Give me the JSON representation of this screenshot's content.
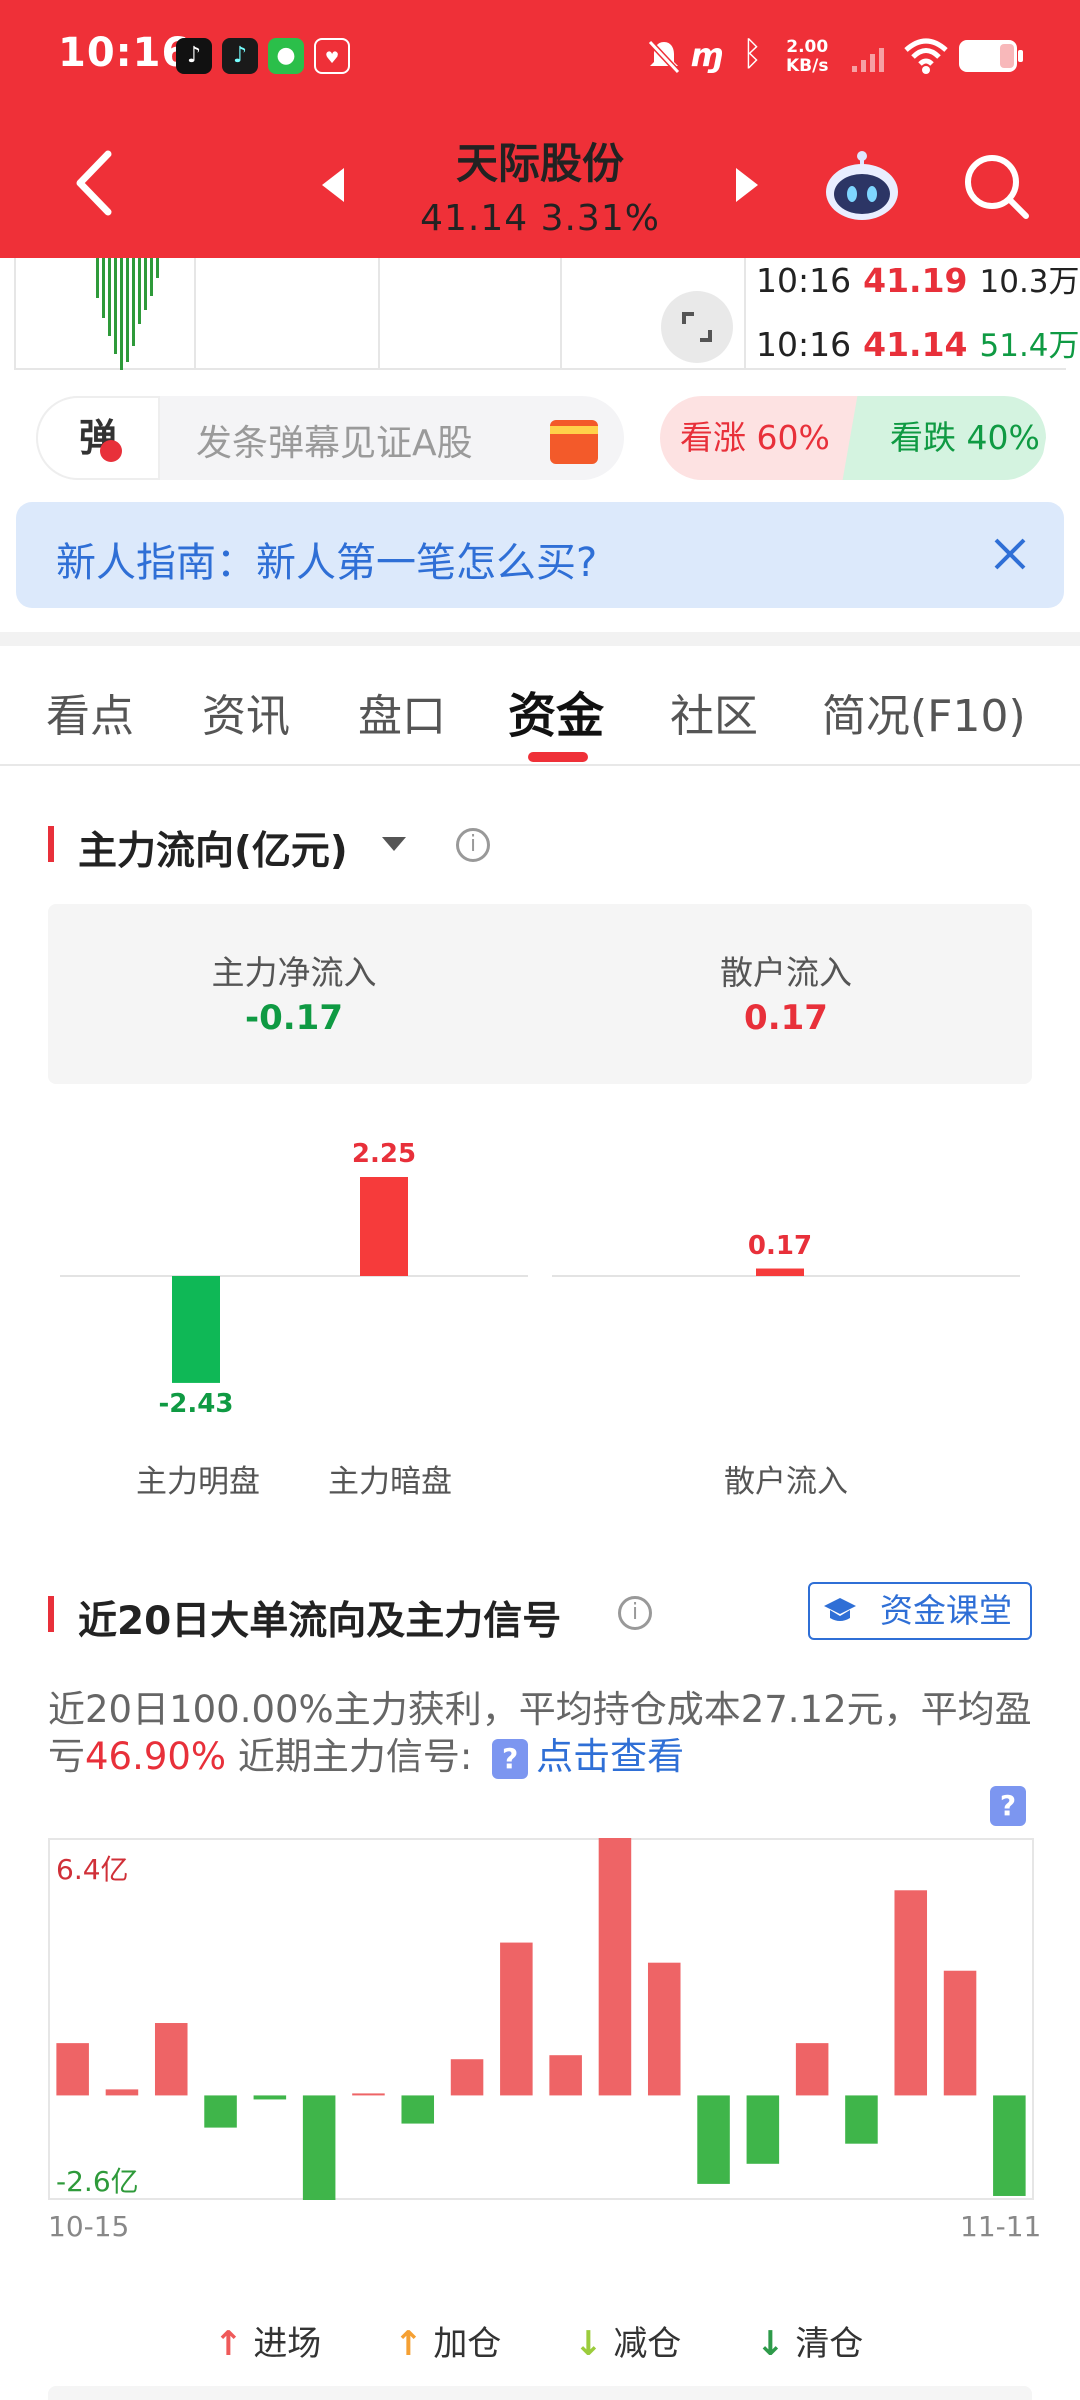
{
  "status_bar": {
    "time": "10:16",
    "net_speed_value": "2.00",
    "net_speed_unit": "KB/s",
    "app_icons": [
      "tiktok-icon",
      "tiktok-lite-icon",
      "wechat-icon",
      "taobao-1111-icon"
    ],
    "status_icons": [
      "mute-icon",
      "nfc-icon",
      "bluetooth-icon",
      "signal-icon",
      "wifi-icon",
      "battery-icon"
    ]
  },
  "header": {
    "stock_name": "天际股份",
    "price_line": "41.14 3.31%"
  },
  "ticks": [
    {
      "time": "10:16",
      "price": "41.19",
      "volume": "10.3万",
      "volume_color": "#222222"
    },
    {
      "time": "10:16",
      "price": "41.14",
      "volume": "51.4万",
      "volume_color": "#0f9a43"
    }
  ],
  "danmu": {
    "icon_label": "弹",
    "placeholder": "发条弹幕见证A股"
  },
  "sentiment": {
    "bull": "看涨 60%",
    "bear": "看跌 40%",
    "bull_pct": 60,
    "bear_pct": 40
  },
  "guide": {
    "text": "新人指南：新人第一笔怎么买?"
  },
  "tabs": [
    "看点",
    "资讯",
    "盘口",
    "资金",
    "社区",
    "简况(F10)"
  ],
  "active_tab": "资金",
  "main_flow": {
    "title": "主力流向(亿元)",
    "net_inflow_label": "主力净流入",
    "net_inflow_value": "-0.17",
    "retail_label": "散户流入",
    "retail_value": "0.17"
  },
  "twenty_day": {
    "title": "近20日大单流向及主力信号",
    "course_button": "资金课堂",
    "summary_prefix": "近20日100.00%主力获利，平均持仓成本27.12元，平均盈亏",
    "summary_highlight": "46.90%",
    "summary_mid": " 近期主力信号:",
    "summary_link": "点击查看",
    "qmark": "?",
    "max_label": "6.4亿",
    "min_label": "-2.6亿",
    "start_date": "10-15",
    "end_date": "11-11"
  },
  "legend": [
    {
      "label": "进场",
      "color": "#ef5a5a",
      "arrow": "↑"
    },
    {
      "label": "加仓",
      "color": "#f5a033",
      "arrow": "↑"
    },
    {
      "label": "减仓",
      "color": "#9ccc3c",
      "arrow": "↓"
    },
    {
      "label": "清仓",
      "color": "#2e9a4a",
      "arrow": "↓"
    }
  ],
  "chart_data": [
    {
      "type": "bar",
      "categories": [
        "主力明盘",
        "主力暗盘",
        "散户流入"
      ],
      "values": [
        -2.43,
        2.25,
        0.17
      ],
      "value_labels": [
        "-2.43",
        "2.25",
        "0.17"
      ],
      "positive_color": "#f63b3b",
      "negative_color": "#0fb856"
    },
    {
      "type": "bar",
      "title": "近20日大单流向及主力信号",
      "ylabel": "亿",
      "ylim": [
        -2.6,
        6.4
      ],
      "values": [
        1.3,
        0.15,
        1.8,
        -0.8,
        -0.1,
        -2.6,
        0.05,
        -0.7,
        0.9,
        3.8,
        1.0,
        6.4,
        3.3,
        -2.2,
        -1.7,
        1.3,
        -1.2,
        5.1,
        3.1,
        -2.5
      ],
      "positive_color": "#ee6466",
      "negative_color": "#3fb54a"
    }
  ]
}
